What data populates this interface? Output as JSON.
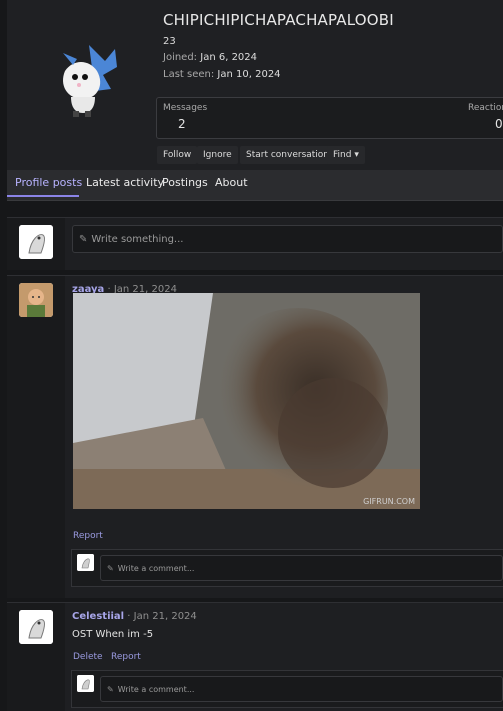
{
  "profile": {
    "username": "CHIPICHIPICHAPACHAPALOOBI",
    "age": "23",
    "joined_label": "Joined:",
    "joined_value": "Jan 6, 2024",
    "last_seen_label": "Last seen:",
    "last_seen_value": "Jan 10, 2024",
    "stats": [
      {
        "label": "Messages",
        "value": "2"
      },
      {
        "label": "Reaction",
        "value": "0"
      }
    ],
    "actions": [
      "Follow",
      "Ignore",
      "Start conversation",
      "Find"
    ]
  },
  "tabs": [
    "Profile posts",
    "Latest activity",
    "Postings",
    "About"
  ],
  "composer": {
    "placeholder": "Write something..."
  },
  "posts": [
    {
      "author": "zaaya",
      "date": "Jan 21, 2024",
      "media_credit": "GIFRUN.COM",
      "actions": [
        "Report"
      ],
      "comment_placeholder": "Write a comment..."
    },
    {
      "author": "Celestiial",
      "date": "Jan 21, 2024",
      "text": "OST When im -5",
      "actions": [
        "Delete",
        "Report"
      ],
      "comment_placeholder": "Write a comment..."
    }
  ],
  "colors": {
    "accent": "#8b84e8",
    "background": "#161719",
    "panel": "#1e1f22"
  }
}
